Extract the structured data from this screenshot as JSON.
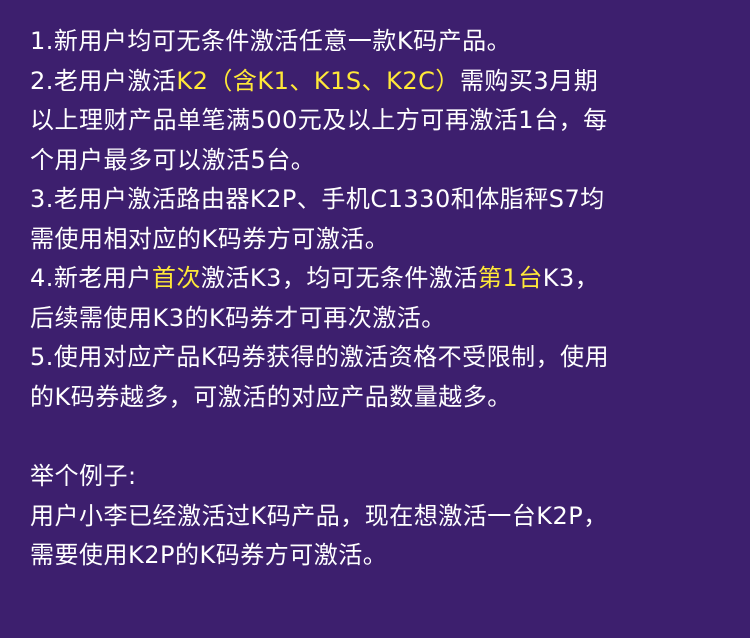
{
  "colors": {
    "background": "#3d1f6e",
    "text": "#ffffff",
    "highlight": "#ffe838"
  },
  "rules": {
    "r1": {
      "line1": "1.新用户均可无条件激活任意一款K码产品。"
    },
    "r2": {
      "line1_a": "2.老用户激活",
      "line1_hl": "K2（含K1、K1S、K2C）",
      "line1_b": "需购买3月期",
      "line2": "以上理财产品单笔满500元及以上方可再激活1台，每",
      "line3": "个用户最多可以激活5台。"
    },
    "r3": {
      "line1": "3.老用户激活路由器K2P、手机C1330和体脂秤S7均",
      "line2": "需使用相对应的K码券方可激活。"
    },
    "r4": {
      "line1_a": "4.新老用户",
      "line1_hl1": "首次",
      "line1_b": "激活K3，均可无条件激活",
      "line1_hl2": "第1台",
      "line1_c": "K3，",
      "line2": "后续需使用K3的K码券才可再次激活。"
    },
    "r5": {
      "line1": "5.使用对应产品K码券获得的激活资格不受限制，使用",
      "line2": "的K码券越多，可激活的对应产品数量越多。"
    }
  },
  "example": {
    "title": "举个例子:",
    "line1": "用户小李已经激活过K码产品，现在想激活一台K2P，",
    "line2": "需要使用K2P的K码券方可激活。"
  }
}
